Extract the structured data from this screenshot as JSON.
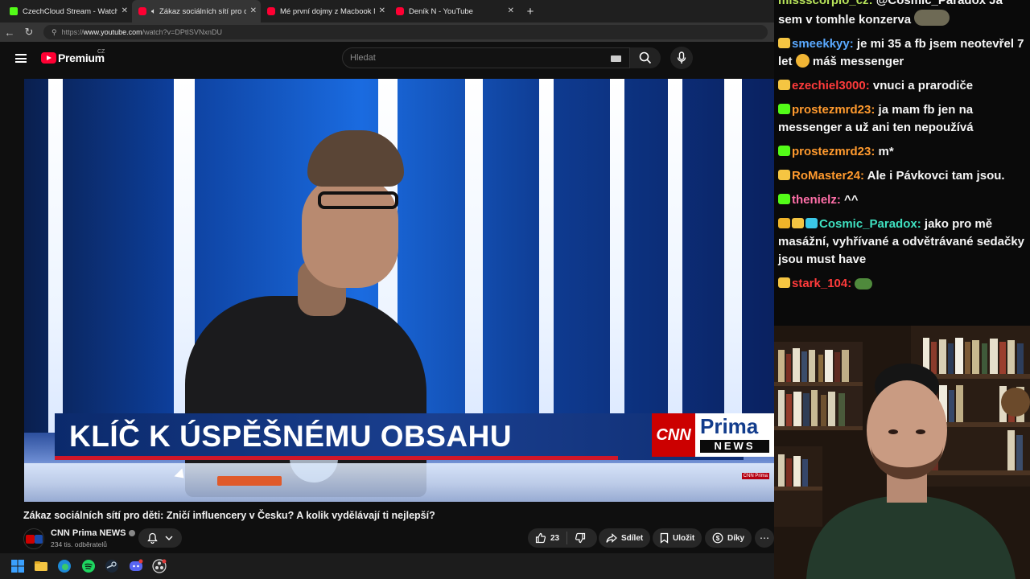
{
  "browser": {
    "tabs": [
      {
        "title": "CzechCloud Stream - Watch Live o",
        "favicon": "kick-icon",
        "active": false
      },
      {
        "title": "Zákaz sociálních sítí pro děti:",
        "favicon": "youtube-icon",
        "active": true,
        "audio": true
      },
      {
        "title": "Mé první dojmy z Macbook Neo.",
        "favicon": "youtube-icon",
        "active": false
      },
      {
        "title": "Deník N - YouTube",
        "favicon": "youtube-icon",
        "active": false
      }
    ],
    "url_prefix": "https://",
    "url_host": "www.youtube.com",
    "url_path": "/watch?v=DPtISVNxnDU"
  },
  "youtube": {
    "logo_text": "Premium",
    "logo_region": "CZ",
    "search_placeholder": "Hledat"
  },
  "video": {
    "headline": "KLÍČ K ÚSPĚŠNÉMU OBSAHU",
    "brand_cnn": "CNN",
    "brand_prima": "Prima",
    "brand_news": "NEWS",
    "mini_logo": "CNN Prima",
    "title": "Zákaz sociálních sítí pro děti: Zničí influencery v Česku? A kolik vydělávají ti nejlepší?",
    "channel_name": "CNN Prima NEWS",
    "subscribers": "234 tis. odběratelů",
    "likes": "23",
    "share_label": "Sdílet",
    "save_label": "Uložit",
    "thanks_label": "Díky"
  },
  "chat": {
    "messages": [
      {
        "badges": [],
        "user": "missscorpio_cz",
        "color": "#b7e35a",
        "text": "@Cosmic_Paradox Ja sem v tomhle konzerva",
        "emote": "konzerva-emote"
      },
      {
        "badges": [
          "gold"
        ],
        "user": "smeekkyy",
        "color": "#5aa9ff",
        "text": "je mi 35 a fb jsem neotevřel 7 let",
        "emote": "laugh-emote",
        "text2": "máš messenger"
      },
      {
        "badges": [
          "gold"
        ],
        "user": "ezechiel3000",
        "color": "#ff3b3b",
        "text": "vnuci a prarodiče"
      },
      {
        "badges": [
          "green"
        ],
        "user": "prostezmrd23",
        "color": "#ff9a2e",
        "text": "ja mam fb jen na messenger a už ani ten nepoužívá"
      },
      {
        "badges": [
          "green"
        ],
        "user": "prostezmrd23",
        "color": "#ff9a2e",
        "text": "m*"
      },
      {
        "badges": [
          "gold"
        ],
        "user": "RoMaster24",
        "color": "#ff9a2e",
        "text": "Ale i Pávkovci tam jsou."
      },
      {
        "badges": [
          "green"
        ],
        "user": "thenielz",
        "color": "#ff6fa8",
        "text": "^^"
      },
      {
        "badges": [
          "crown",
          "gold",
          "cube"
        ],
        "user": "Cosmic_Paradox",
        "color": "#3fe0c0",
        "text": "jako pro mě masážní, vyhřívané a odvětrávané sedačky jsou must have"
      },
      {
        "badges": [
          "gold"
        ],
        "user": "stark_104",
        "color": "#ff3b3b",
        "text": "",
        "emote": "frog-emote"
      }
    ]
  }
}
